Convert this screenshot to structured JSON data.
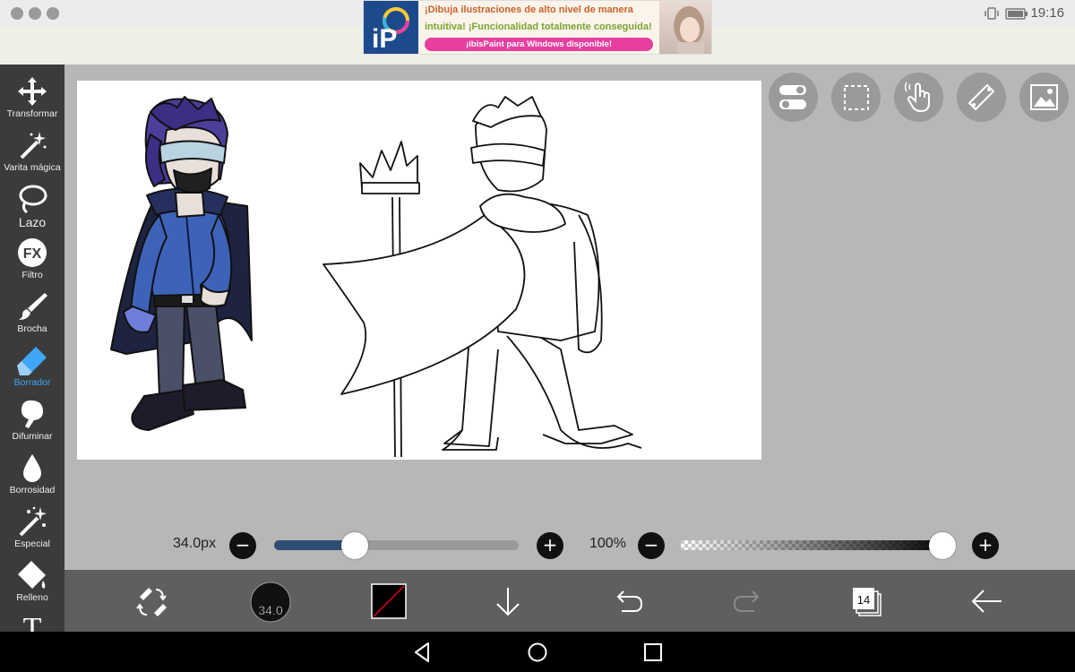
{
  "status_bar": {
    "time": "19:16",
    "icons": [
      "notification-icon",
      "chrome-icon",
      "app-icon",
      "vibrate-icon",
      "battery-icon"
    ]
  },
  "ad": {
    "logo_text": "iP",
    "line1": "¡Dibuja ilustraciones de alto nivel de manera",
    "line2": "intuitiva! ¡Funcionalidad totalmente conseguida!",
    "cta": "¡ibisPaint para Windows disponible!"
  },
  "left_toolbar": {
    "tools": [
      {
        "label": "Transformar",
        "icon": "move-icon"
      },
      {
        "label": "Varita mágica",
        "icon": "magic-wand-icon"
      },
      {
        "label": "Lazo",
        "icon": "lasso-icon"
      },
      {
        "label": "Filtro",
        "icon": "fx-icon",
        "icon_text": "FX"
      },
      {
        "label": "Brocha",
        "icon": "brush-icon"
      },
      {
        "label": "Borrador",
        "icon": "eraser-icon",
        "active": true
      },
      {
        "label": "Difuminar",
        "icon": "smudge-icon"
      },
      {
        "label": "Borrosidad",
        "icon": "blur-drop-icon"
      },
      {
        "label": "Especial",
        "icon": "special-icon"
      },
      {
        "label": "Relleno",
        "icon": "fill-icon"
      },
      {
        "label": "",
        "icon": "text-icon",
        "icon_text": "T"
      }
    ]
  },
  "top_right_buttons": [
    "toggle-icon",
    "selection-icon",
    "touch-icon",
    "ruler-icon",
    "image-icon"
  ],
  "brush_size": {
    "value_text": "34.0px",
    "fraction": 0.33
  },
  "opacity": {
    "value_text": "100%",
    "fraction": 1.0
  },
  "bottom_toolbar": {
    "brush_size_badge": "34.0",
    "layer_count": "14",
    "colors": {
      "accent": "#e3001b",
      "brush_fill": "#2e4e73"
    }
  }
}
